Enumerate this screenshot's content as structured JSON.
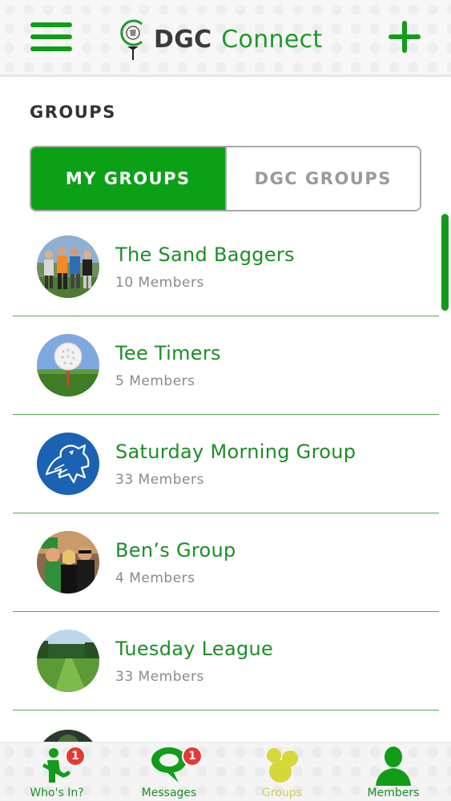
{
  "header": {
    "brand_bold": "DGC",
    "brand_light": "Connect",
    "menu_icon": "hamburger-menu-icon",
    "add_icon": "plus-icon"
  },
  "page_title": "GROUPS",
  "segments": {
    "my_groups": "MY GROUPS",
    "dgc_groups": "DGC GROUPS",
    "selected": "MY GROUPS"
  },
  "groups": [
    {
      "name": "The Sand Baggers",
      "members": "10 Members"
    },
    {
      "name": "Tee Timers",
      "members": "5 Members"
    },
    {
      "name": "Saturday Morning Group",
      "members": "33 Members"
    },
    {
      "name": "Ben’s Group",
      "members": "4 Members"
    },
    {
      "name": "Tuesday League",
      "members": "33 Members"
    }
  ],
  "tabs": [
    {
      "label": "Who's In?",
      "badge": "1",
      "icon": "golfer-icon"
    },
    {
      "label": "Messages",
      "badge": "1",
      "icon": "chat-bubble-icon"
    },
    {
      "label": "Groups",
      "icon": "group-circles-icon"
    },
    {
      "label": "Members",
      "icon": "person-icon"
    }
  ],
  "colors": {
    "brand_green": "#0ca016",
    "text_green": "#1b8e25",
    "badge_red": "#e53935",
    "inactive_tab": "#cdd05a"
  }
}
